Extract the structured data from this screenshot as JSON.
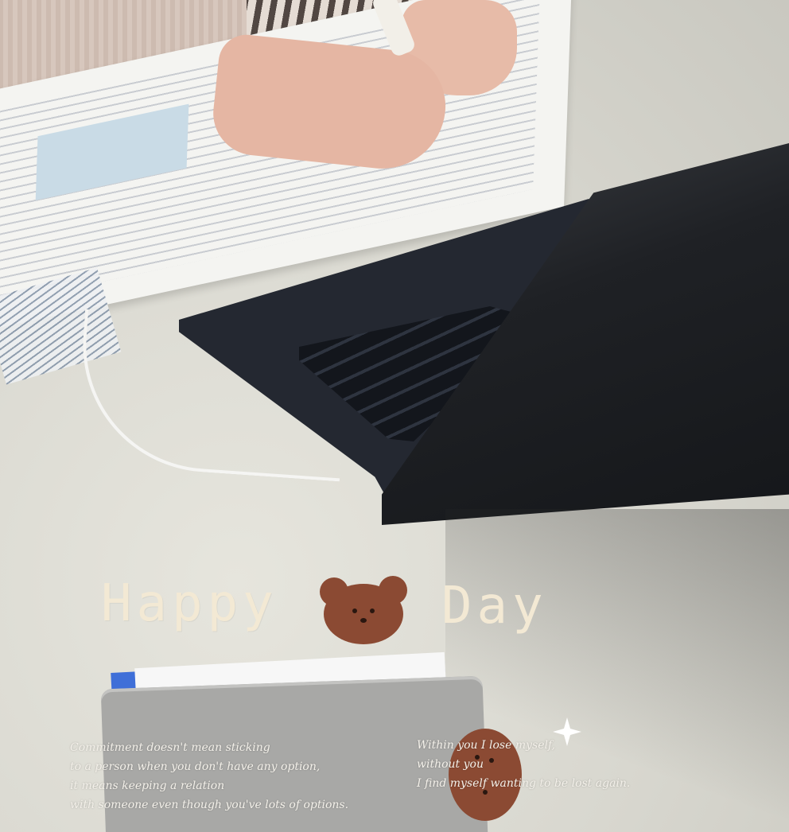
{
  "overlay": {
    "title_left": "Happy",
    "title_right": "Day",
    "title_color": "#f3e9d4",
    "bear_color": "#8b4a33",
    "bear_icon": "bear-face-icon",
    "sparkle_icon": "sparkle-icon"
  },
  "quote_left": {
    "lines": [
      "Commitment doesn't mean sticking",
      "to a person when you don't have any option,",
      "it means keeping a relation",
      "with someone even though you've lots of options."
    ]
  },
  "quote_right": {
    "lines": [
      "Within you I lose myself,",
      "without you",
      "I find myself wanting to be lost again."
    ]
  }
}
